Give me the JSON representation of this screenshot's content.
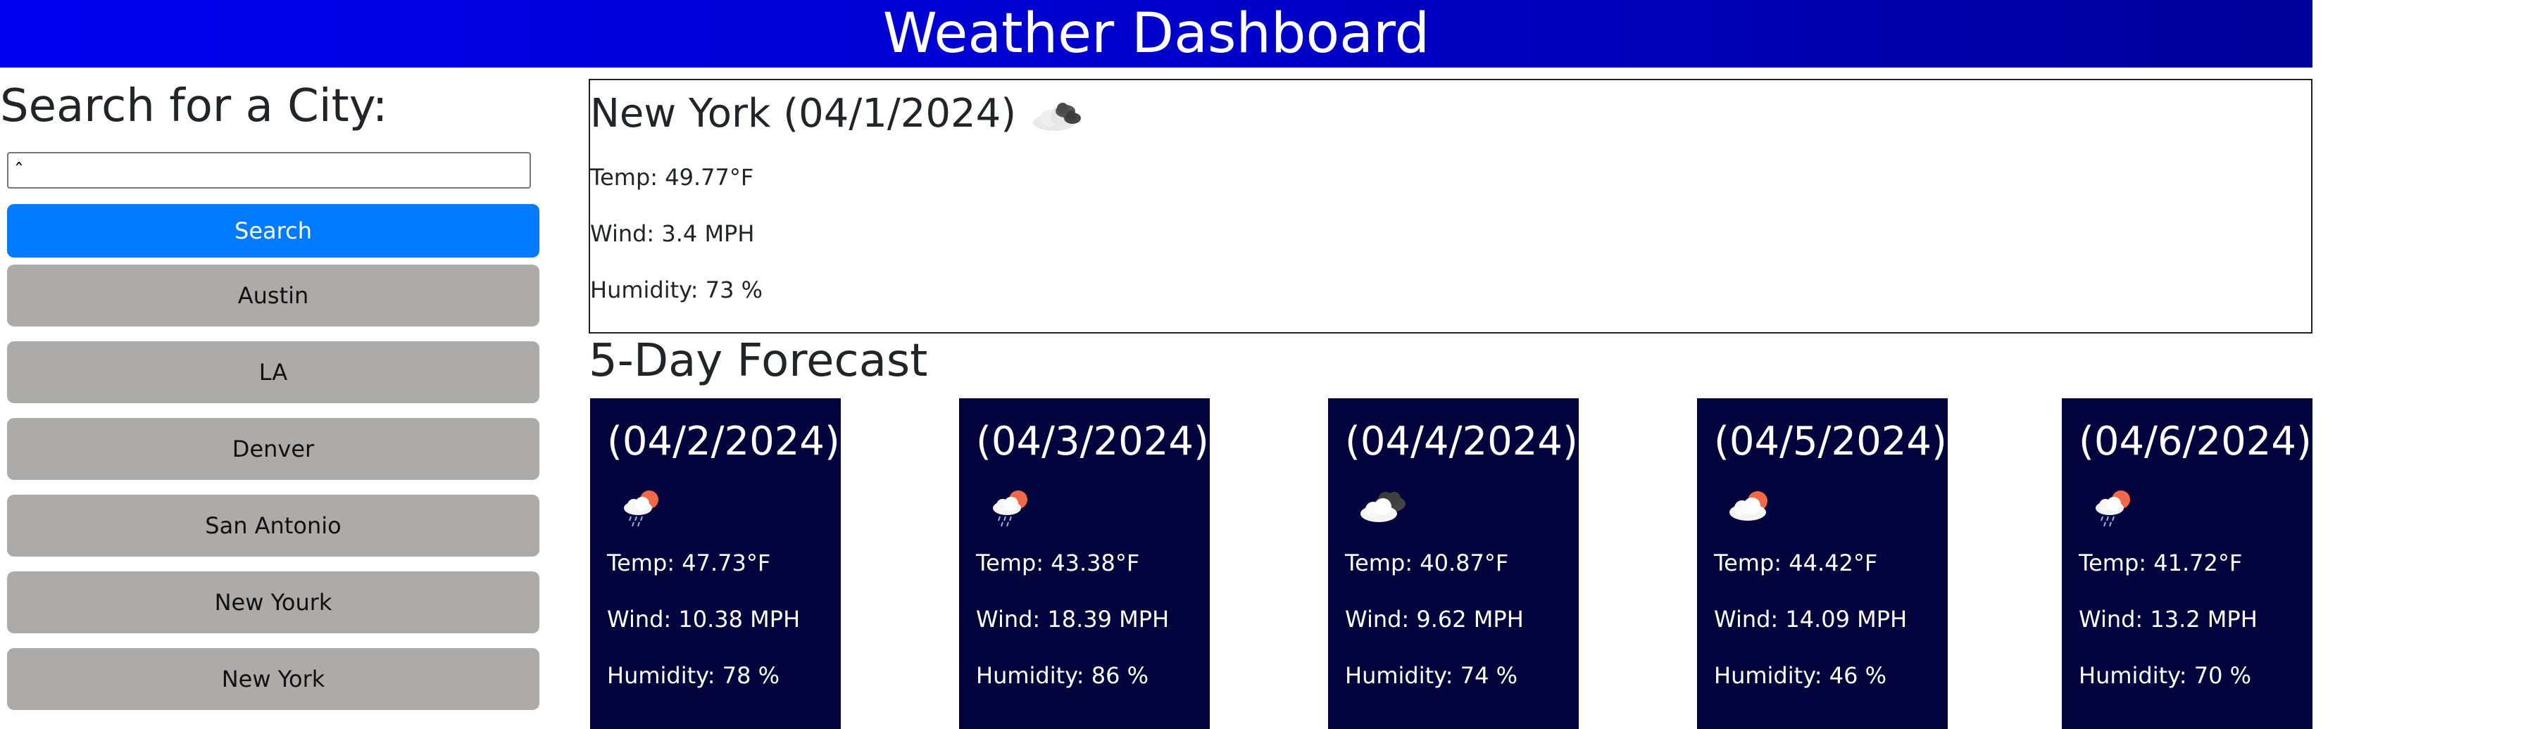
{
  "header": {
    "title": "Weather Dashboard"
  },
  "sidebar": {
    "heading": "Search for a City:",
    "search_value": "ˆ",
    "search_button": "Search",
    "history": [
      "Austin",
      "LA",
      "Denver",
      "San Antonio",
      "New Yourk",
      "New York"
    ]
  },
  "current": {
    "title": "New York (04/1/2024)",
    "icon": "broken-clouds-icon",
    "temp": "Temp: 49.77°F",
    "wind": "Wind: 3.4 MPH",
    "humidity": "Humidity: 73 %"
  },
  "forecast": {
    "heading": "5-Day Forecast",
    "days": [
      {
        "date": "(04/2/2024)",
        "icon": "rain-sun-icon",
        "temp": "Temp: 47.73°F",
        "wind": "Wind: 10.38 MPH",
        "humidity": "Humidity: 78 %"
      },
      {
        "date": "(04/3/2024)",
        "icon": "rain-sun-icon",
        "temp": "Temp: 43.38°F",
        "wind": "Wind: 18.39 MPH",
        "humidity": "Humidity: 86 %"
      },
      {
        "date": "(04/4/2024)",
        "icon": "overcast-clouds-icon",
        "temp": "Temp: 40.87°F",
        "wind": "Wind: 9.62 MPH",
        "humidity": "Humidity: 74 %"
      },
      {
        "date": "(04/5/2024)",
        "icon": "partly-cloudy-icon",
        "temp": "Temp: 44.42°F",
        "wind": "Wind: 14.09 MPH",
        "humidity": "Humidity: 46 %"
      },
      {
        "date": "(04/6/2024)",
        "icon": "rain-sun-icon",
        "temp": "Temp: 41.72°F",
        "wind": "Wind: 13.2 MPH",
        "humidity": "Humidity: 70 %"
      }
    ]
  },
  "colors": {
    "header_start": "#0000f0",
    "header_end": "#00009a",
    "search_button": "#007bff",
    "history_button": "#adaaaa",
    "forecast_card": "#03033e"
  }
}
